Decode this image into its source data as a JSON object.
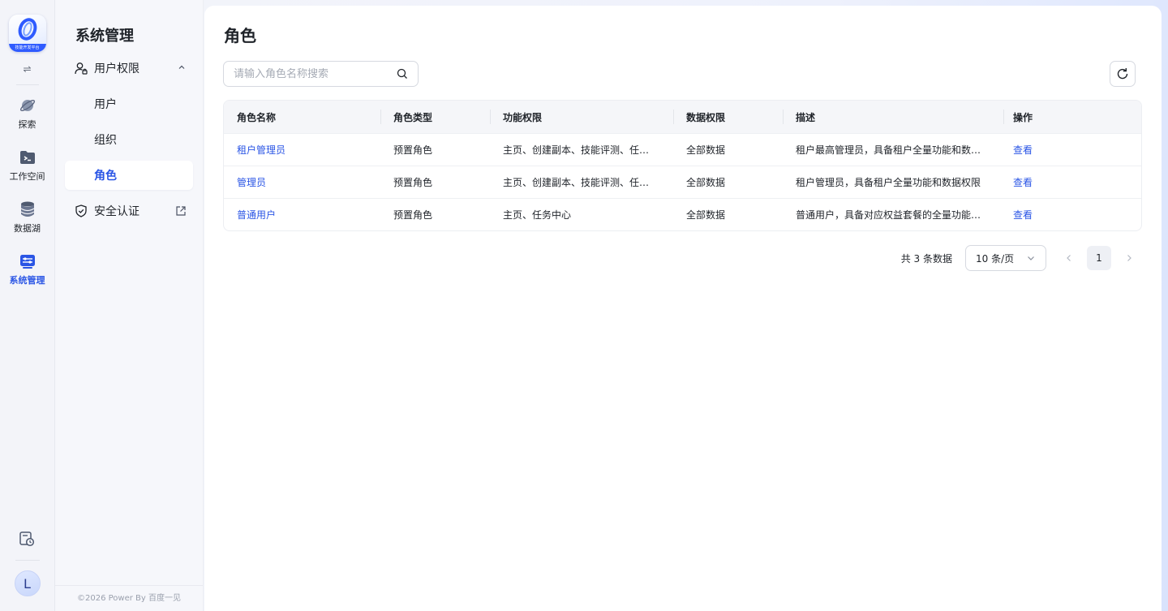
{
  "rail": {
    "logo_badge": "技能开发平台",
    "items": [
      {
        "label": "探索",
        "icon": "planet-icon",
        "active": false
      },
      {
        "label": "工作空间",
        "icon": "terminal-folder-icon",
        "active": false
      },
      {
        "label": "数据湖",
        "icon": "database-icon",
        "active": false
      },
      {
        "label": "系统管理",
        "icon": "settings-panel-icon",
        "active": true
      }
    ],
    "avatar_initial": "L"
  },
  "sidebar": {
    "title": "系统管理",
    "group_user_permission": "用户权限",
    "sub_items": [
      "用户",
      "组织",
      "角色"
    ],
    "active_sub": "角色",
    "security": "安全认证",
    "footer": "©2026 Power By 百度一见"
  },
  "main": {
    "title": "角色",
    "search_placeholder": "请输入角色名称搜索",
    "columns": [
      "角色名称",
      "角色类型",
      "功能权限",
      "数据权限",
      "描述",
      "操作"
    ],
    "rows": [
      {
        "name": "租户管理员",
        "type": "预置角色",
        "func": "主页、创建副本、技能评测、任务...",
        "data": "全部数据",
        "desc": "租户最高管理员，具备租户全量功能和数据...",
        "action": "查看"
      },
      {
        "name": "管理员",
        "type": "预置角色",
        "func": "主页、创建副本、技能评测、任务...",
        "data": "全部数据",
        "desc": "租户管理员，具备租户全量功能和数据权限",
        "action": "查看"
      },
      {
        "name": "普通用户",
        "type": "预置角色",
        "func": "主页、任务中心",
        "data": "全部数据",
        "desc": "普通用户，具备对应权益套餐的全量功能和...",
        "action": "查看"
      }
    ],
    "pagination": {
      "total": "共 3 条数据",
      "page_size": "10 条/页",
      "current_page": "1"
    }
  },
  "colors": {
    "accent": "#2a55e5",
    "text": "#1f2329"
  }
}
